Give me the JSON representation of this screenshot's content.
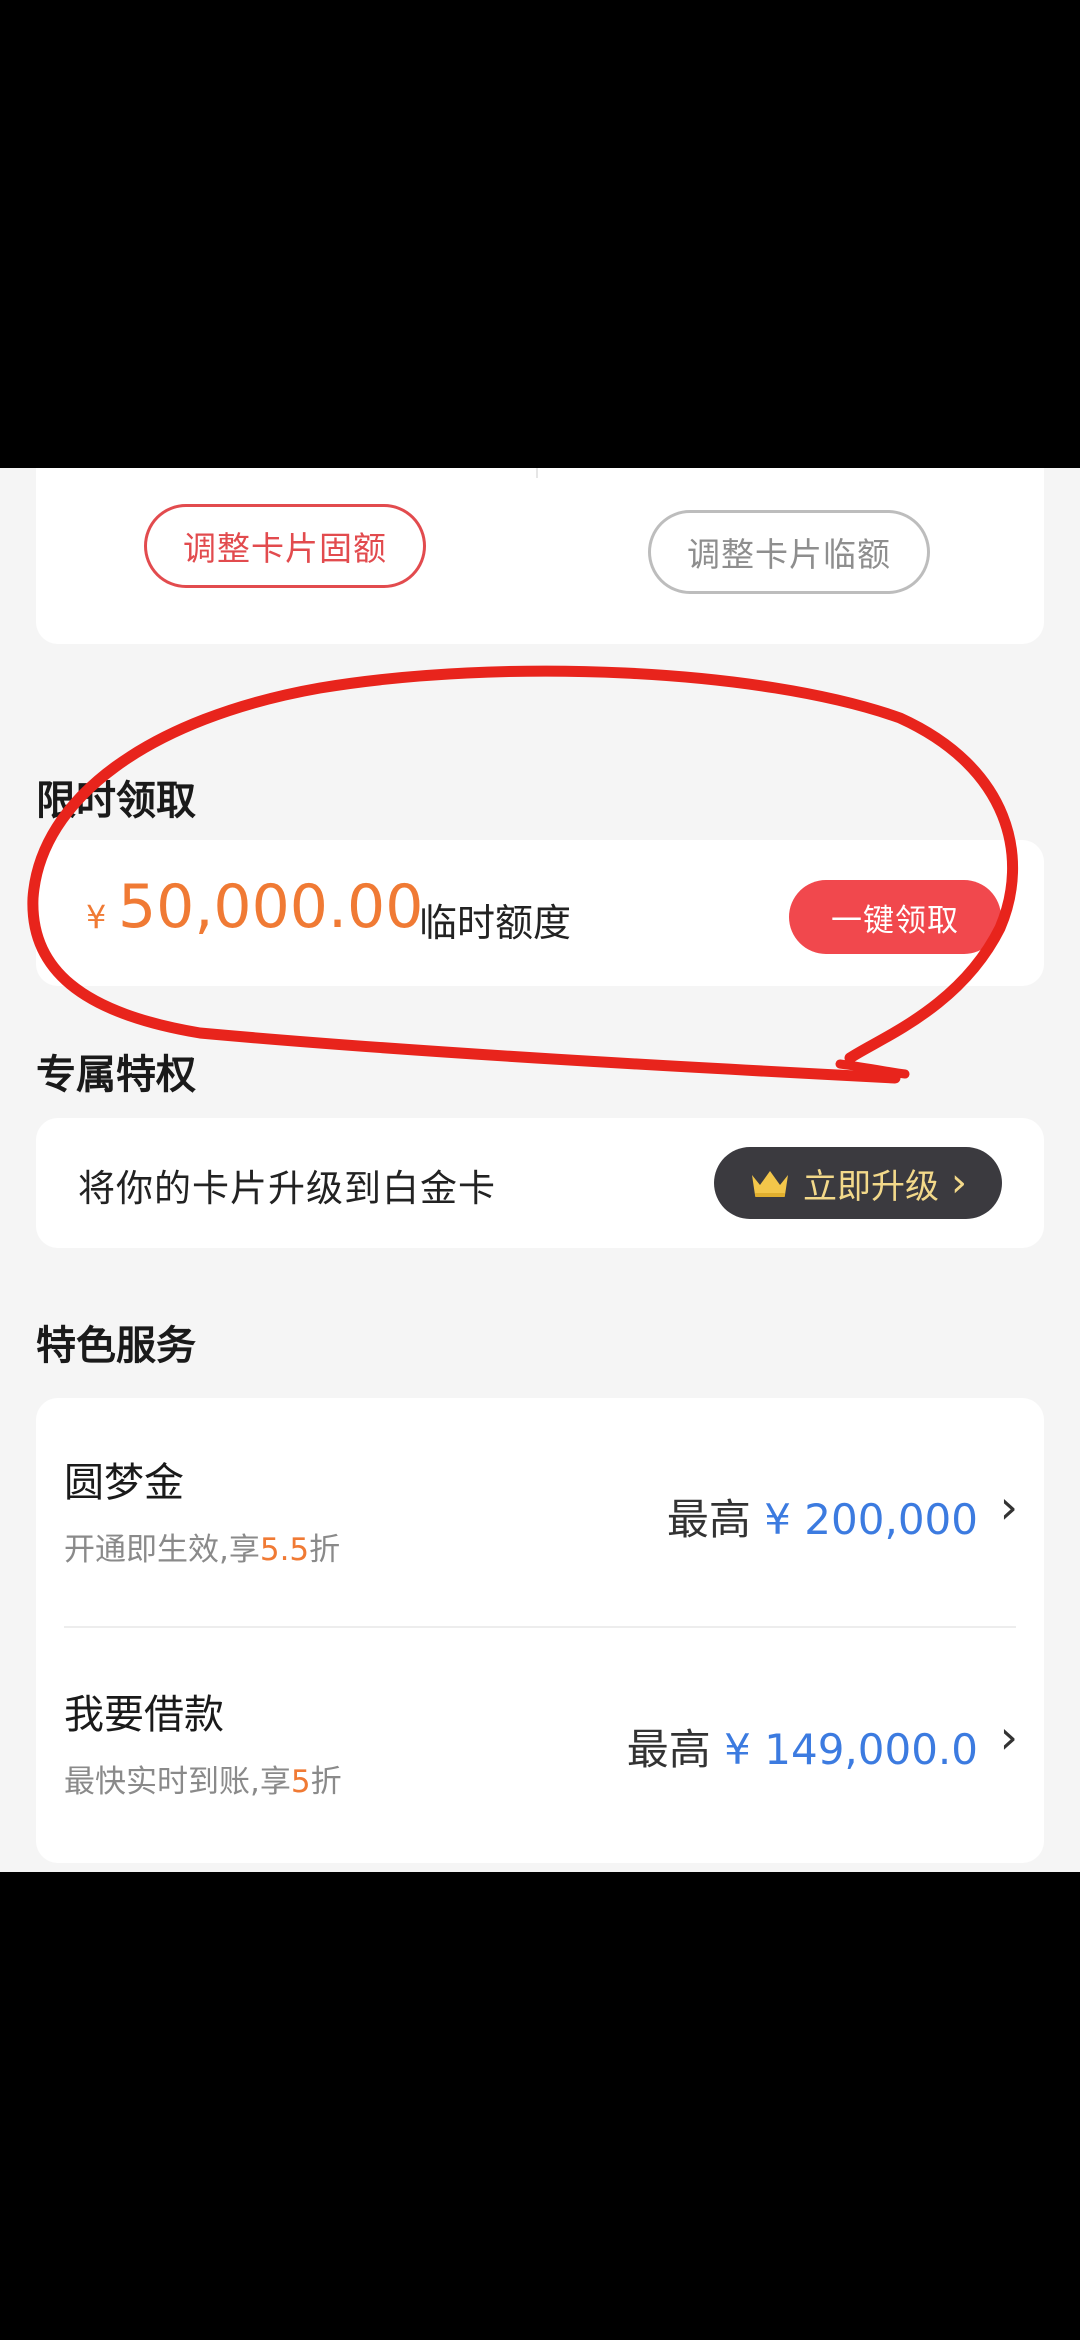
{
  "top_card": {
    "fixed_limit_button": "调整卡片固额",
    "temp_limit_button": "调整卡片临额"
  },
  "limited_offer": {
    "title": "限时领取",
    "currency": "¥",
    "amount": "50,000.00",
    "amount_label": "临时额度",
    "claim_button": "一键领取"
  },
  "privilege": {
    "title": "专属特权",
    "text": "将你的卡片升级到白金卡",
    "upgrade_button": "立即升级",
    "icon": "crown-icon"
  },
  "services": {
    "title": "特色服务",
    "items": [
      {
        "name": "圆梦金",
        "sub_prefix": "开通即生效,享",
        "sub_highlight": "5.5",
        "sub_suffix": "折",
        "amount_prefix": "最高",
        "amount": "¥ 200,000"
      },
      {
        "name": "我要借款",
        "sub_prefix": "最快实时到账,享",
        "sub_highlight": "5",
        "sub_suffix": "折",
        "amount_prefix": "最高",
        "amount": "¥ 149,000.0"
      }
    ]
  },
  "colors": {
    "accent_red": "#e24b4e",
    "amount_orange": "#f07a34",
    "link_blue": "#3c7be0",
    "annotation_red": "#e8241c"
  }
}
